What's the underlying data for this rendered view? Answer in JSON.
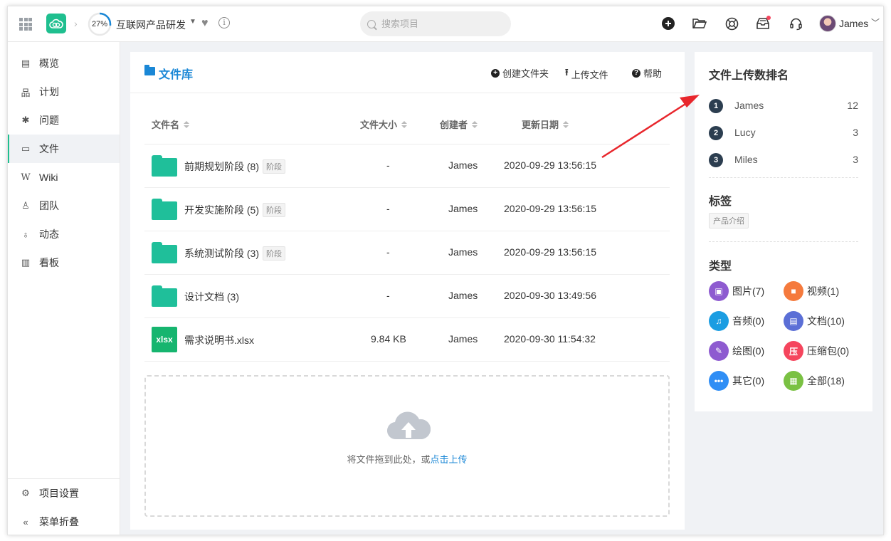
{
  "header": {
    "progress_percent": "27%",
    "progress_value": 0.27,
    "project_title": "互联网产品研发",
    "search_placeholder": "搜索项目",
    "user_name": "James",
    "accent": "#1fbf8f"
  },
  "sidebar": {
    "items": [
      {
        "label": "概览",
        "icon": "overview-icon"
      },
      {
        "label": "计划",
        "icon": "plan-icon"
      },
      {
        "label": "问题",
        "icon": "bug-icon"
      },
      {
        "label": "文件",
        "icon": "folder-icon"
      },
      {
        "label": "Wiki",
        "icon": "wiki-icon"
      },
      {
        "label": "团队",
        "icon": "team-icon"
      },
      {
        "label": "动态",
        "icon": "activity-icon"
      },
      {
        "label": "看板",
        "icon": "board-icon"
      }
    ],
    "settings_label": "项目设置",
    "collapse_label": "菜单折叠"
  },
  "main": {
    "title": "文件库",
    "buttons": {
      "create_folder": "创建文件夹",
      "upload": "上传文件",
      "help": "帮助"
    },
    "columns": [
      "文件名",
      "文件大小",
      "创建者",
      "更新日期"
    ],
    "rows": [
      {
        "name": "前期规划阶段 (8)",
        "tag": "阶段",
        "size": "-",
        "creator": "James",
        "date": "2020-09-29 13:56:15",
        "type": "folder"
      },
      {
        "name": "开发实施阶段 (5)",
        "tag": "阶段",
        "size": "-",
        "creator": "James",
        "date": "2020-09-29 13:56:15",
        "type": "folder"
      },
      {
        "name": "系统测试阶段 (3)",
        "tag": "阶段",
        "size": "-",
        "creator": "James",
        "date": "2020-09-29 13:56:15",
        "type": "folder"
      },
      {
        "name": "设计文档 (3)",
        "tag": "",
        "size": "-",
        "creator": "James",
        "date": "2020-09-30 13:49:56",
        "type": "folder"
      },
      {
        "name": "需求说明书.xlsx",
        "tag": "",
        "size": "9.84 KB",
        "creator": "James",
        "date": "2020-09-30 11:54:32",
        "type": "xlsx",
        "icon_text": "xlsx"
      }
    ],
    "drop_text": "将文件拖到此处，或",
    "drop_link": "点击上传"
  },
  "right": {
    "rank_title": "文件上传数排名",
    "ranks": [
      {
        "num": "1",
        "name": "James",
        "count": "12"
      },
      {
        "num": "2",
        "name": "Lucy",
        "count": "3"
      },
      {
        "num": "3",
        "name": "Miles",
        "count": "3"
      }
    ],
    "tags_title": "标签",
    "tags": [
      "产品介绍"
    ],
    "types_title": "类型",
    "types": [
      {
        "label": "图片(7)",
        "color": "#8e5bd0",
        "glyph": "▣"
      },
      {
        "label": "视频(1)",
        "color": "#f57a3d",
        "glyph": "■"
      },
      {
        "label": "音频(0)",
        "color": "#1b9de2",
        "glyph": "♫"
      },
      {
        "label": "文档(10)",
        "color": "#5b6fd6",
        "glyph": "▤"
      },
      {
        "label": "绘图(0)",
        "color": "#8e5bd0",
        "glyph": "✎"
      },
      {
        "label": "压缩包(0)",
        "color": "#f5455d",
        "glyph": "压"
      },
      {
        "label": "其它(0)",
        "color": "#2f8ef5",
        "glyph": "•••"
      },
      {
        "label": "全部(18)",
        "color": "#7ac143",
        "glyph": "▦"
      }
    ]
  }
}
